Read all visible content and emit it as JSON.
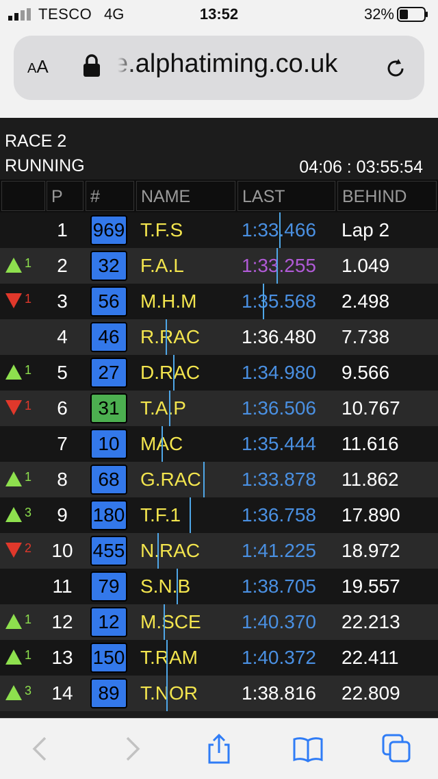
{
  "status_bar": {
    "carrier": "TESCO",
    "network": "4G",
    "time": "13:52",
    "battery": "32%"
  },
  "browser": {
    "text_size_small": "A",
    "text_size_large": "A",
    "url": "e.alphatiming.co.uk"
  },
  "race": {
    "title": "RACE 2",
    "status": "RUNNING",
    "timer": "04:06 : 03:55:54"
  },
  "table": {
    "headers": {
      "pos": "P",
      "number": "#",
      "name": "NAME",
      "last": "LAST",
      "behind": "BEHIND"
    },
    "rows": [
      {
        "change": "",
        "dir": "",
        "pos": "1",
        "number": "969",
        "badge_color": "#3378ea",
        "name": "T.F.S",
        "last": "1:33.466",
        "last_color": "#4a90e2",
        "behind": "Lap 2"
      },
      {
        "change": "1",
        "dir": "up",
        "pos": "2",
        "number": "32",
        "badge_color": "#3378ea",
        "name": "F.A.L",
        "last": "1:33.255",
        "last_color": "#b05ad6",
        "behind": "1.049"
      },
      {
        "change": "1",
        "dir": "down",
        "pos": "3",
        "number": "56",
        "badge_color": "#3378ea",
        "name": "M.H.M",
        "last": "1:35.568",
        "last_color": "#4a90e2",
        "behind": "2.498"
      },
      {
        "change": "",
        "dir": "",
        "pos": "4",
        "number": "46",
        "badge_color": "#3378ea",
        "name": "R.RAC",
        "last": "1:36.480",
        "last_color": "#ffffff",
        "behind": "7.738"
      },
      {
        "change": "1",
        "dir": "up",
        "pos": "5",
        "number": "27",
        "badge_color": "#3378ea",
        "name": "D.RAC",
        "last": "1:34.980",
        "last_color": "#4a90e2",
        "behind": "9.566"
      },
      {
        "change": "1",
        "dir": "down",
        "pos": "6",
        "number": "31",
        "badge_color": "#4caf50",
        "name": "T.A.P",
        "last": "1:36.506",
        "last_color": "#4a90e2",
        "behind": "10.767"
      },
      {
        "change": "",
        "dir": "",
        "pos": "7",
        "number": "10",
        "badge_color": "#3378ea",
        "name": "MAC",
        "last": "1:35.444",
        "last_color": "#4a90e2",
        "behind": "11.616"
      },
      {
        "change": "1",
        "dir": "up",
        "pos": "8",
        "number": "68",
        "badge_color": "#3378ea",
        "name": "G.RAC",
        "last": "1:33.878",
        "last_color": "#4a90e2",
        "behind": "11.862"
      },
      {
        "change": "3",
        "dir": "up",
        "pos": "9",
        "number": "180",
        "badge_color": "#3378ea",
        "name": "T.F.1",
        "last": "1:36.758",
        "last_color": "#4a90e2",
        "behind": "17.890"
      },
      {
        "change": "2",
        "dir": "down",
        "pos": "10",
        "number": "455",
        "badge_color": "#3378ea",
        "name": "N.RAC",
        "last": "1:41.225",
        "last_color": "#4a90e2",
        "behind": "18.972"
      },
      {
        "change": "",
        "dir": "",
        "pos": "11",
        "number": "79",
        "badge_color": "#3378ea",
        "name": "S.N.B",
        "last": "1:38.705",
        "last_color": "#4a90e2",
        "behind": "19.557"
      },
      {
        "change": "1",
        "dir": "up",
        "pos": "12",
        "number": "12",
        "badge_color": "#3378ea",
        "name": "M.SCE",
        "last": "1:40.370",
        "last_color": "#4a90e2",
        "behind": "22.213"
      },
      {
        "change": "1",
        "dir": "up",
        "pos": "13",
        "number": "150",
        "badge_color": "#3378ea",
        "name": "T.RAM",
        "last": "1:40.372",
        "last_color": "#4a90e2",
        "behind": "22.411"
      },
      {
        "change": "3",
        "dir": "up",
        "pos": "14",
        "number": "89",
        "badge_color": "#3378ea",
        "name": "T.NOR",
        "last": "1:38.816",
        "last_color": "#ffffff",
        "behind": "22.809"
      }
    ]
  },
  "colors": {
    "up": "#8ee04e",
    "down": "#e0382b",
    "name_yellow": "#f3e54e",
    "ios_blue": "#2f7cf6"
  },
  "toolbar": {
    "icons": [
      "back-icon",
      "forward-icon",
      "share-icon",
      "bookmarks-icon",
      "tabs-icon"
    ]
  }
}
